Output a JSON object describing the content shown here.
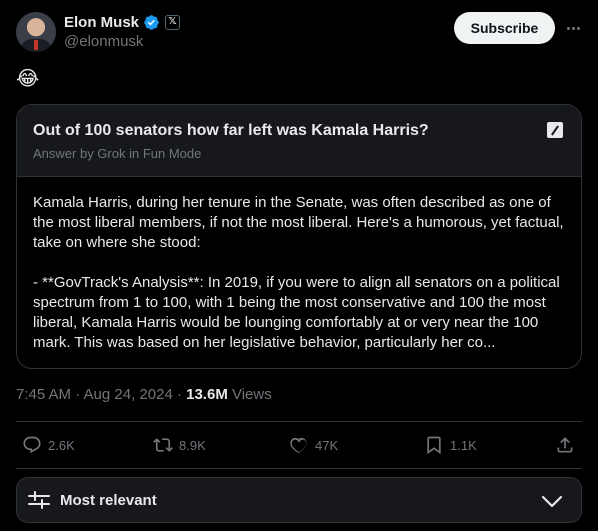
{
  "author": {
    "name": "Elon Musk",
    "handle": "@elonmusk",
    "affiliation_badge": "𝕏"
  },
  "subscribe_label": "Subscribe",
  "post_text": "😂",
  "grok_card": {
    "title": "Out of 100 senators how far left was Kamala Harris?",
    "subtitle": "Answer by Grok in Fun Mode",
    "paragraph_1": "Kamala Harris, during her tenure in the Senate, was often described as one of the most liberal members, if not the most liberal. Here's a humorous, yet factual, take on where she stood:",
    "paragraph_2": "- **GovTrack's Analysis**: In 2019, if you were to align all senators on a political spectrum from 1 to 100, with 1 being the most conservative and 100 the most liberal, Kamala Harris would be lounging comfortably at or very near the 100 mark. This was based on her legislative behavior, particularly her co..."
  },
  "meta": {
    "timestamp": "7:45 AM · Aug 24, 2024 · ",
    "views_count": "13.6M",
    "views_label": " Views"
  },
  "actions": {
    "replies": "2.6K",
    "reposts": "8.9K",
    "likes": "47K",
    "bookmarks": "1.1K"
  },
  "reply_filter": {
    "label": "Most relevant"
  },
  "colors": {
    "background": "#000000",
    "text": "#e7e9ea",
    "muted": "#71767b",
    "border": "#2f3336",
    "verified": "#1d9bf0"
  },
  "icons": [
    "verified-badge-icon",
    "x-logo-icon",
    "more-icon",
    "grok-icon",
    "reply-icon",
    "repost-icon",
    "like-icon",
    "bookmark-icon",
    "share-icon",
    "filter-icon",
    "chevron-down-icon"
  ]
}
